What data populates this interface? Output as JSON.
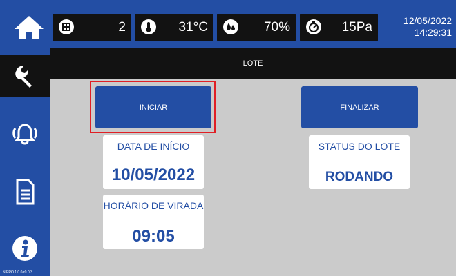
{
  "header": {
    "sensors": [
      {
        "icon": "counter-icon",
        "value": "2"
      },
      {
        "icon": "thermometer-icon",
        "value": "31°C"
      },
      {
        "icon": "humidity-icon",
        "value": "70%"
      },
      {
        "icon": "pressure-gauge-icon",
        "value": "15Pa"
      }
    ],
    "date": "12/05/2022",
    "time": "14:29:31"
  },
  "sidebar": {
    "items": [
      {
        "icon": "wrench-icon",
        "active": true
      },
      {
        "icon": "alarm-bell-icon",
        "active": false
      },
      {
        "icon": "document-icon",
        "active": false
      },
      {
        "icon": "info-icon",
        "active": false
      }
    ],
    "version": "N.PRO 1.0.0-r0.0.3"
  },
  "page": {
    "title": "LOTE",
    "start_button": "INICIAR",
    "finish_button": "FINALIZAR"
  },
  "cards": {
    "start_date": {
      "label": "DATA DE INÍCIO",
      "value": "10/05/2022"
    },
    "turn_time": {
      "label": "HORÁRIO DE VIRADA",
      "value": "09:05"
    },
    "status": {
      "label": "STATUS DO LOTE",
      "value": "RODANDO"
    }
  },
  "colors": {
    "primary": "#234ea4",
    "dark": "#121212",
    "content_bg": "#cbcbcb",
    "highlight": "#e01f25"
  }
}
